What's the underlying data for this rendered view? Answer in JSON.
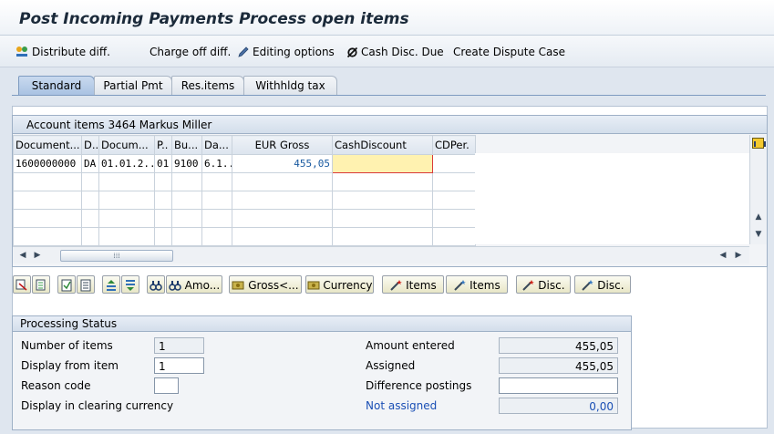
{
  "window": {
    "title": "Post Incoming Payments Process open items"
  },
  "toolbar": {
    "items": [
      {
        "label": "Distribute diff."
      },
      {
        "label": "Charge off diff."
      },
      {
        "label": "Editing options"
      },
      {
        "label": "Cash Disc. Due"
      },
      {
        "label": "Create Dispute Case"
      }
    ]
  },
  "tabs": [
    {
      "label": "Standard",
      "active": true
    },
    {
      "label": "Partial Pmt"
    },
    {
      "label": "Res.items"
    },
    {
      "label": "Withhldg tax"
    }
  ],
  "account_items": {
    "title": "Account items 3464 Markus Miller",
    "columns": [
      "Document...",
      "D..",
      "Docum...",
      "P..",
      "Bu...",
      "Da...",
      "EUR Gross",
      "CashDiscount",
      "CDPer."
    ],
    "rows": [
      [
        "1600000000",
        "DA",
        "01.01.2...",
        "01",
        "9100",
        "6.1...",
        "455,05",
        "",
        ""
      ]
    ]
  },
  "buttons": {
    "amount": "Amo...",
    "gross": "Gross<...",
    "currency": "Currency",
    "items1": "Items",
    "items2": "Items",
    "disc1": "Disc.",
    "disc2": "Disc."
  },
  "processing": {
    "title": "Processing Status",
    "number_of_items_label": "Number of items",
    "number_of_items": "1",
    "display_from_label": "Display from item",
    "display_from": "1",
    "reason_code_label": "Reason code",
    "reason_code": "",
    "clearing_currency_label": "Display in clearing currency",
    "amount_entered_label": "Amount entered",
    "amount_entered": "455,05",
    "assigned_label": "Assigned",
    "assigned": "455,05",
    "difference_label": "Difference postings",
    "difference": "",
    "not_assigned_label": "Not assigned",
    "not_assigned": "0,00"
  },
  "colors": {
    "accent": "#1a4fb5",
    "highlight": "#fff2b0",
    "frame": "#9eb0c6"
  }
}
